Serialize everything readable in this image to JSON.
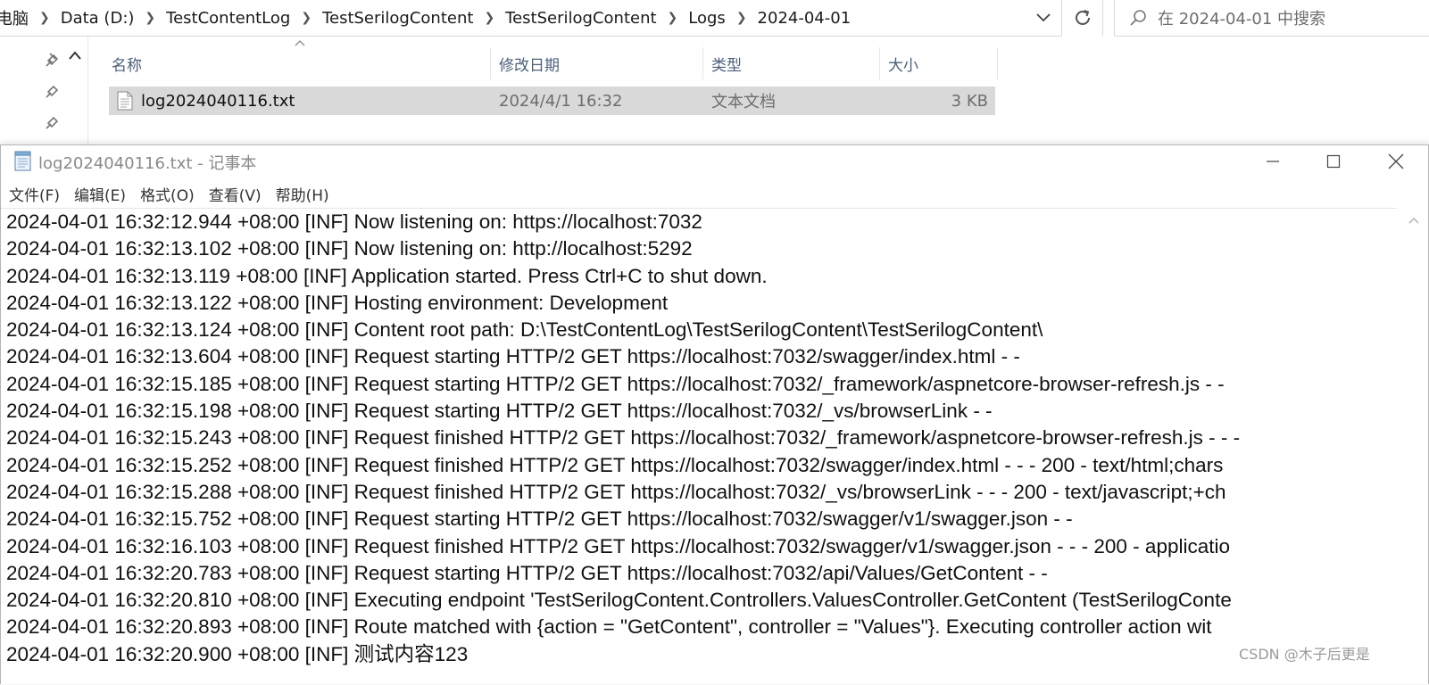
{
  "explorer": {
    "breadcrumb": [
      "电脑",
      "Data (D:)",
      "TestContentLog",
      "TestSerilogContent",
      "TestSerilogContent",
      "Logs",
      "2024-04-01"
    ],
    "search_placeholder": "在 2024-04-01 中搜索",
    "columns": {
      "name": "名称",
      "modified": "修改日期",
      "type": "类型",
      "size": "大小"
    },
    "file": {
      "name": "log2024040116.txt",
      "modified": "2024/4/1 16:32",
      "type": "文本文档",
      "size": "3 KB"
    }
  },
  "notepad": {
    "title": "log2024040116.txt - 记事本",
    "menu": [
      "文件(F)",
      "编辑(E)",
      "格式(O)",
      "查看(V)",
      "帮助(H)"
    ],
    "lines": [
      "2024-04-01 16:32:12.944 +08:00 [INF] Now listening on: https://localhost:7032",
      "2024-04-01 16:32:13.102 +08:00 [INF] Now listening on: http://localhost:5292",
      "2024-04-01 16:32:13.119 +08:00 [INF] Application started. Press Ctrl+C to shut down.",
      "2024-04-01 16:32:13.122 +08:00 [INF] Hosting environment: Development",
      "2024-04-01 16:32:13.124 +08:00 [INF] Content root path: D:\\TestContentLog\\TestSerilogContent\\TestSerilogContent\\",
      "2024-04-01 16:32:13.604 +08:00 [INF] Request starting HTTP/2 GET https://localhost:7032/swagger/index.html - -",
      "2024-04-01 16:32:15.185 +08:00 [INF] Request starting HTTP/2 GET https://localhost:7032/_framework/aspnetcore-browser-refresh.js - -",
      "2024-04-01 16:32:15.198 +08:00 [INF] Request starting HTTP/2 GET https://localhost:7032/_vs/browserLink - -",
      "2024-04-01 16:32:15.243 +08:00 [INF] Request finished HTTP/2 GET https://localhost:7032/_framework/aspnetcore-browser-refresh.js - - -",
      "2024-04-01 16:32:15.252 +08:00 [INF] Request finished HTTP/2 GET https://localhost:7032/swagger/index.html - - - 200 - text/html;chars",
      "2024-04-01 16:32:15.288 +08:00 [INF] Request finished HTTP/2 GET https://localhost:7032/_vs/browserLink - - - 200 - text/javascript;+ch",
      "2024-04-01 16:32:15.752 +08:00 [INF] Request starting HTTP/2 GET https://localhost:7032/swagger/v1/swagger.json - -",
      "2024-04-01 16:32:16.103 +08:00 [INF] Request finished HTTP/2 GET https://localhost:7032/swagger/v1/swagger.json - - - 200 - applicatio",
      "2024-04-01 16:32:20.783 +08:00 [INF] Request starting HTTP/2 GET https://localhost:7032/api/Values/GetContent - -",
      "2024-04-01 16:32:20.810 +08:00 [INF] Executing endpoint 'TestSerilogContent.Controllers.ValuesController.GetContent (TestSerilogConte",
      "2024-04-01 16:32:20.893 +08:00 [INF] Route matched with {action = \"GetContent\", controller = \"Values\"}. Executing controller action wit",
      "2024-04-01 16:32:20.900 +08:00 [INF] 测试内容123"
    ]
  },
  "watermark": "CSDN @木子后更是"
}
